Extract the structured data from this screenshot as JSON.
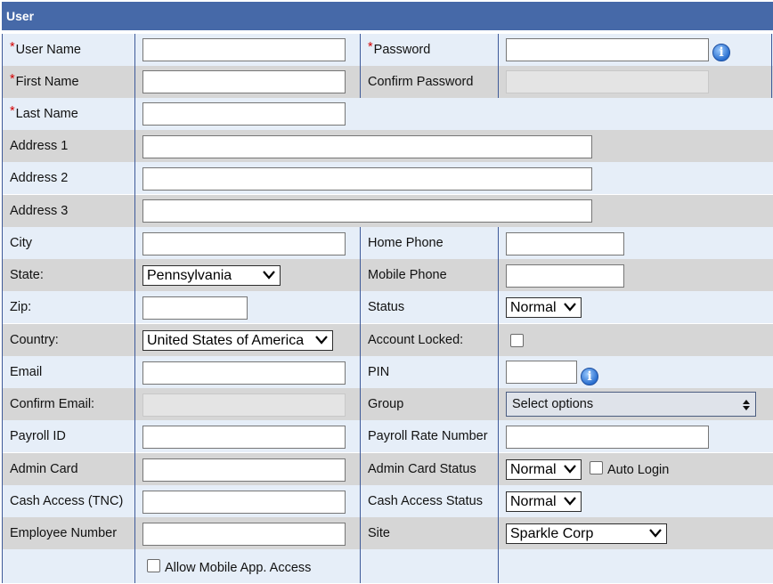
{
  "section_title": "User",
  "fields": {
    "user_name": "User Name",
    "password": "Password",
    "first_name": "First Name",
    "confirm_password": "Confirm Password",
    "last_name": "Last Name",
    "address1": "Address 1",
    "address2": "Address 2",
    "address3": "Address 3",
    "city": "City",
    "home_phone": "Home Phone",
    "state": "State:",
    "mobile_phone": "Mobile Phone",
    "zip": "Zip:",
    "status": "Status",
    "country": "Country:",
    "account_locked": "Account Locked:",
    "email": "Email",
    "pin": "PIN",
    "confirm_email": "Confirm Email:",
    "group": "Group",
    "payroll_id": "Payroll ID",
    "payroll_rate": "Payroll Rate Number",
    "admin_card": "Admin Card",
    "admin_card_status": "Admin Card Status",
    "auto_login": "Auto Login",
    "cash_access": "Cash Access (TNC)",
    "cash_access_status": "Cash Access Status",
    "employee_number": "Employee Number",
    "site": "Site",
    "allow_mobile": "Allow Mobile App. Access"
  },
  "required_marker": "*",
  "info_glyph": "i",
  "values": {
    "state": "Pennsylvania",
    "status": "Normal",
    "country": "United States of America",
    "group_placeholder": "Select options",
    "admin_card_status": "Normal",
    "cash_access_status": "Normal",
    "site": "Sparkle Corp"
  },
  "colors": {
    "header_bg": "#4669a8",
    "row_light": "#e6eef8",
    "row_dark": "#d6d6d6",
    "required": "#d40000"
  }
}
